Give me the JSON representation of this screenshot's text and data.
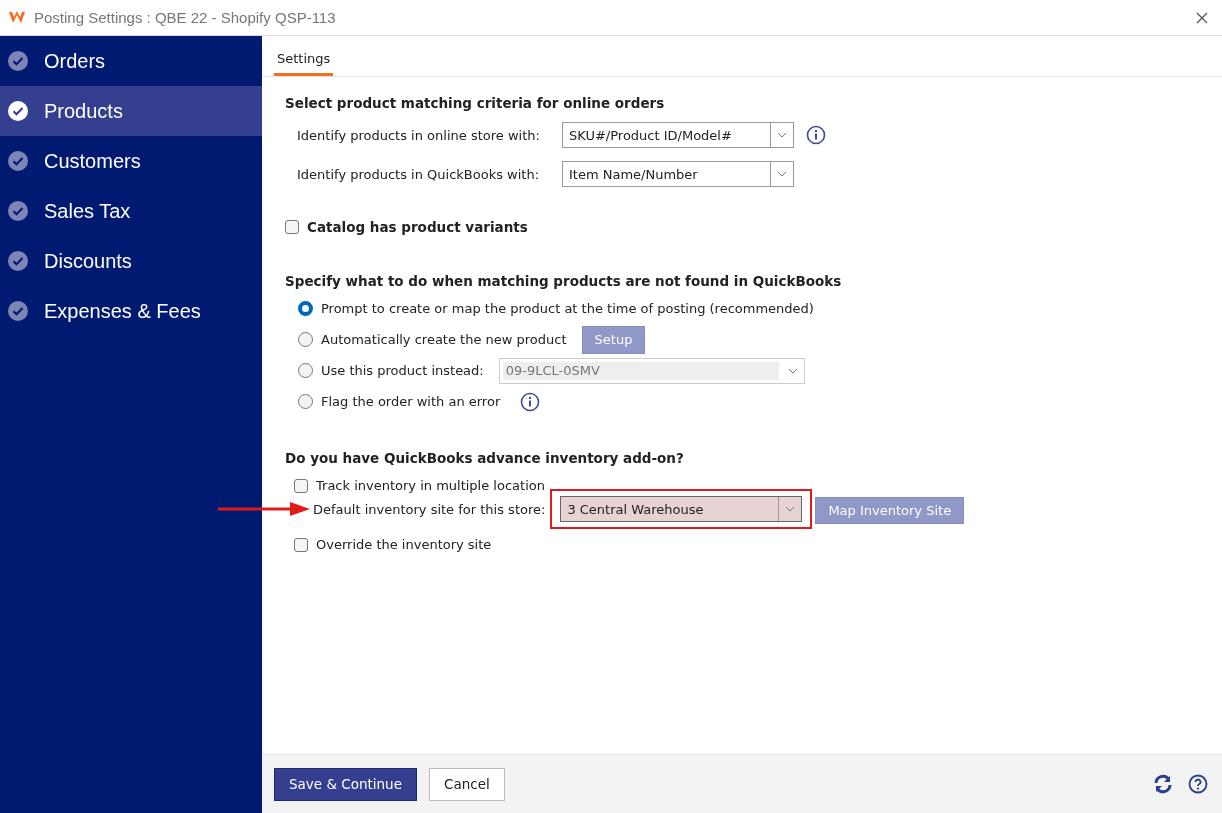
{
  "window": {
    "title": "Posting Settings : QBE 22 - Shopify QSP-113"
  },
  "sidebar": {
    "items": [
      {
        "label": "Orders",
        "selected": false
      },
      {
        "label": "Products",
        "selected": true
      },
      {
        "label": "Customers",
        "selected": false
      },
      {
        "label": "Sales Tax",
        "selected": false
      },
      {
        "label": "Discounts",
        "selected": false
      },
      {
        "label": "Expenses & Fees",
        "selected": false
      }
    ]
  },
  "tabs": [
    {
      "label": "Settings",
      "selected": true
    }
  ],
  "matching": {
    "heading": "Select product matching criteria for online orders",
    "fields": [
      {
        "label": "Identify products in online store with:",
        "value": "SKU#/Product ID/Model#",
        "info": true
      },
      {
        "label": "Identify products in QuickBooks with:",
        "value": "Item Name/Number",
        "info": false
      }
    ]
  },
  "variants": {
    "label": "Catalog has product variants",
    "checked": false
  },
  "not_found": {
    "heading": "Specify what to do when matching products are not found in QuickBooks",
    "options": [
      {
        "kind": "plain",
        "label": "Prompt to create or map the product at the time of posting (recommended)",
        "selected": true
      },
      {
        "kind": "button",
        "label": "Automatically create the new product",
        "selected": false,
        "button": {
          "label": "Setup",
          "disabled": true
        }
      },
      {
        "kind": "dropdown",
        "label": "Use this product instead:",
        "selected": false,
        "dropdown": {
          "value": "09-9LCL-0SMV",
          "disabled": true
        }
      },
      {
        "kind": "info",
        "label": "Flag the order with an error",
        "selected": false
      }
    ]
  },
  "inventory": {
    "heading": "Do you have QuickBooks advance inventory add-on?",
    "track": {
      "label": "Track inventory in multiple location",
      "checked": false
    },
    "site": {
      "label": "Default inventory site for this store:",
      "value": "3 Central Warehouse",
      "highlighted": true
    },
    "map_button": {
      "label": "Map Inventory Site",
      "disabled": true
    },
    "override": {
      "label": "Override the inventory site",
      "checked": false
    }
  },
  "footer": {
    "buttons": [
      {
        "label": "Save & Continue",
        "kind": "primary"
      },
      {
        "label": "Cancel",
        "kind": "secondary"
      }
    ]
  }
}
